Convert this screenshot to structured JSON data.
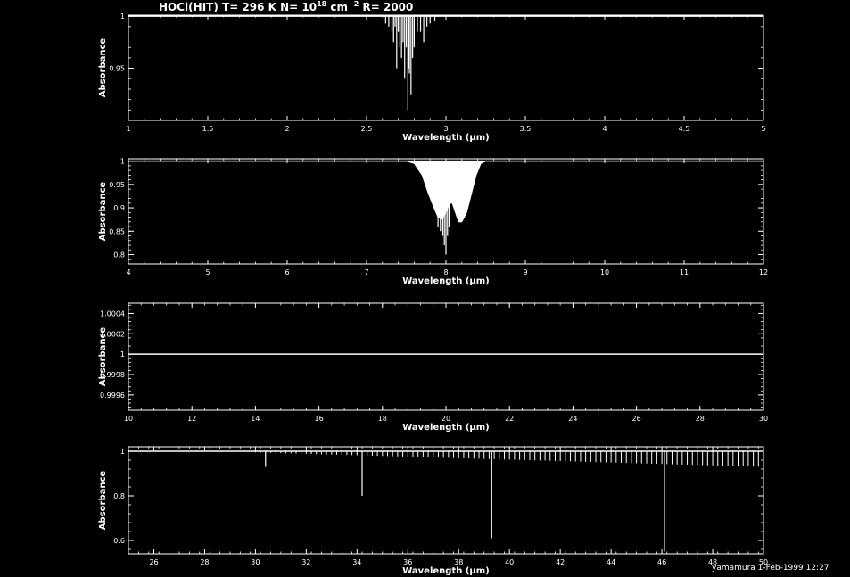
{
  "header": {
    "title_main": "HOCl(HIT) T= 296 K N= 10",
    "title_exp1": "18",
    "title_mid": " cm",
    "title_exp2": "−2",
    "title_end": " R= 2000"
  },
  "footer": {
    "signature": "yamamura 1-Feb-1999 12:27"
  },
  "chart_data": [
    {
      "type": "line",
      "panel": 1,
      "xlabel": "Wavelength (μm)",
      "ylabel": "Absorbance",
      "xlim": [
        1,
        5
      ],
      "ylim": [
        0.9,
        1.001
      ],
      "xticks": [
        1,
        1.5,
        2,
        2.5,
        3,
        3.5,
        4,
        4.5,
        5
      ],
      "xtick_labels": [
        "1",
        "1.5",
        "2",
        "2.5",
        "3",
        "3.5",
        "4",
        "4.5",
        "5"
      ],
      "yticks": [
        0.95,
        1
      ],
      "ytick_labels": [
        "0.95",
        "1"
      ],
      "baseline": 1.0,
      "lines": [
        [
          2.62,
          0.993
        ],
        [
          2.64,
          0.99
        ],
        [
          2.66,
          0.985
        ],
        [
          2.67,
          0.975
        ],
        [
          2.68,
          0.99
        ],
        [
          2.69,
          0.95
        ],
        [
          2.7,
          0.985
        ],
        [
          2.71,
          0.97
        ],
        [
          2.72,
          0.96
        ],
        [
          2.73,
          0.975
        ],
        [
          2.74,
          0.94
        ],
        [
          2.75,
          0.97
        ],
        [
          2.76,
          0.91
        ],
        [
          2.765,
          0.95
        ],
        [
          2.77,
          0.945
        ],
        [
          2.78,
          0.925
        ],
        [
          2.79,
          0.96
        ],
        [
          2.8,
          0.97
        ],
        [
          2.82,
          0.985
        ],
        [
          2.84,
          0.985
        ],
        [
          2.86,
          0.975
        ],
        [
          2.88,
          0.99
        ],
        [
          2.9,
          0.993
        ],
        [
          2.93,
          0.995
        ]
      ],
      "envelope": []
    },
    {
      "type": "line",
      "panel": 2,
      "xlabel": "Wavelength (μm)",
      "ylabel": "Absorbance",
      "xlim": [
        4,
        12
      ],
      "ylim": [
        0.78,
        1.005
      ],
      "xticks": [
        4,
        5,
        6,
        7,
        8,
        9,
        10,
        11,
        12
      ],
      "xtick_labels": [
        "4",
        "5",
        "6",
        "7",
        "8",
        "9",
        "10",
        "11",
        "12"
      ],
      "yticks": [
        0.8,
        0.85,
        0.9,
        0.95,
        1
      ],
      "ytick_labels": [
        "0.8",
        "0.85",
        "0.9",
        "0.95",
        "1"
      ],
      "baseline": 1.0,
      "lines": [
        [
          7.9,
          0.86
        ],
        [
          7.93,
          0.85
        ],
        [
          7.96,
          0.84
        ],
        [
          7.98,
          0.82
        ],
        [
          8.0,
          0.8
        ],
        [
          8.02,
          0.84
        ],
        [
          8.04,
          0.86
        ]
      ],
      "envelope": [
        [
          7.5,
          1.0
        ],
        [
          7.6,
          0.995
        ],
        [
          7.7,
          0.97
        ],
        [
          7.78,
          0.93
        ],
        [
          7.85,
          0.9
        ],
        [
          7.9,
          0.88
        ],
        [
          7.95,
          0.875
        ],
        [
          8.0,
          0.89
        ],
        [
          8.05,
          0.91
        ],
        [
          8.08,
          0.91
        ],
        [
          8.12,
          0.89
        ],
        [
          8.16,
          0.87
        ],
        [
          8.2,
          0.87
        ],
        [
          8.26,
          0.89
        ],
        [
          8.32,
          0.93
        ],
        [
          8.38,
          0.97
        ],
        [
          8.44,
          0.995
        ],
        [
          8.5,
          1.0
        ]
      ]
    },
    {
      "type": "line",
      "panel": 3,
      "xlabel": "Wavelength (μm)",
      "ylabel": "Absorbance",
      "xlim": [
        10,
        30
      ],
      "ylim": [
        0.99945,
        1.0005
      ],
      "xticks": [
        10,
        12,
        14,
        16,
        18,
        20,
        22,
        24,
        26,
        28,
        30
      ],
      "xtick_labels": [
        "10",
        "12",
        "14",
        "16",
        "18",
        "20",
        "22",
        "24",
        "26",
        "28",
        "30"
      ],
      "yticks": [
        0.9996,
        0.9998,
        1,
        1.0002,
        1.0004
      ],
      "ytick_labels": [
        "0.9996",
        "0.9998",
        "1",
        "1.0002",
        "1.0004"
      ],
      "baseline": 1.0,
      "lines": [],
      "envelope": []
    },
    {
      "type": "line",
      "panel": 4,
      "xlabel": "Wavelength (μm)",
      "ylabel": "Absorbance",
      "xlim": [
        25,
        50
      ],
      "ylim": [
        0.54,
        1.02
      ],
      "xticks": [
        26,
        28,
        30,
        32,
        34,
        36,
        38,
        40,
        42,
        44,
        46,
        48,
        50
      ],
      "xtick_labels": [
        "26",
        "28",
        "30",
        "32",
        "34",
        "36",
        "38",
        "40",
        "42",
        "44",
        "46",
        "48",
        "50"
      ],
      "yticks": [
        0.6,
        0.8,
        1
      ],
      "ytick_labels": [
        "0.6",
        "0.8",
        "1"
      ],
      "baseline": 1.0,
      "lines": [
        [
          30.4,
          0.93
        ],
        [
          34.2,
          0.8
        ],
        [
          39.3,
          0.61
        ],
        [
          46.1,
          0.55
        ]
      ],
      "comb": {
        "start": 30.0,
        "end": 50.0,
        "spacing": 0.2,
        "depth_start": 0.995,
        "depth_end": 0.93
      },
      "envelope": []
    }
  ]
}
